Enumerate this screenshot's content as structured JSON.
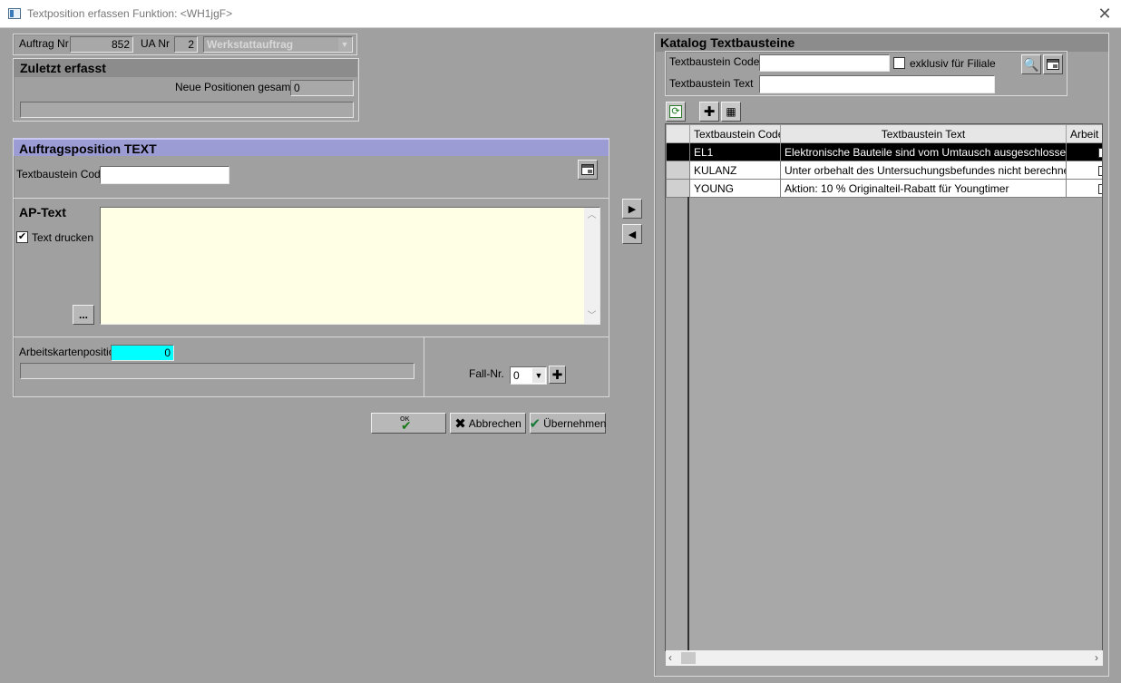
{
  "window": {
    "title": "Textposition erfassen   Funktion: <WH1jgF>"
  },
  "header": {
    "auftrag_label": "Auftrag Nr",
    "auftrag_value": "852",
    "ua_label": "UA Nr",
    "ua_value": "2",
    "auftragsart": "Werkstattauftrag"
  },
  "zuletzt": {
    "title": "Zuletzt erfasst",
    "neue_label": "Neue Positionen gesamt",
    "neue_value": "0"
  },
  "auftragsposition": {
    "title": "Auftragsposition  TEXT",
    "code_label": "Textbaustein Code",
    "code_value": "",
    "ap_text_label": "AP-Text",
    "text_drucken_label": "Text drucken",
    "text_drucken_checked": true,
    "ellipsis_label": "...",
    "ap_text_value": "",
    "arbeitskarte_label": "Arbeitskartenposition",
    "arbeitskarte_value": "0",
    "fall_label": "Fall-Nr.",
    "fall_value": "0"
  },
  "buttons": {
    "ok": "",
    "abbrechen": "Abbrechen",
    "uebernehmen": "Übernehmen"
  },
  "katalog": {
    "title": "Katalog Textbausteine",
    "code_label": "Textbaustein Code",
    "text_label": "Textbaustein Text",
    "exklusiv_label": "exklusiv für Filiale",
    "columns": [
      "Textbaustein Code",
      "Textbaustein Text",
      "Arbeit"
    ],
    "rows": [
      {
        "code": "EL1",
        "text": "Elektronische Bauteile sind vom Umtausch ausgeschlossen."
      },
      {
        "code": "KULANZ",
        "text": "Unter orbehalt des Untersuchungsbefundes nicht berechneter K"
      },
      {
        "code": "YOUNG",
        "text": "Aktion: 10 % Originalteil-Rabatt für Youngtimer"
      }
    ],
    "selected_row": 0
  },
  "icons": {
    "close": "close-icon",
    "calendar": "calendar-icon",
    "search": "search-icon",
    "refresh": "refresh-icon",
    "add": "plus-icon",
    "arrow_right": "arrow-right-icon",
    "arrow_left": "arrow-left-icon"
  },
  "colors": {
    "background": "#a0a0a0",
    "ap_text_bg": "#ffffe6",
    "arbeitskarte_bg": "#00ffff",
    "section_blue": "#9c9cd4"
  }
}
